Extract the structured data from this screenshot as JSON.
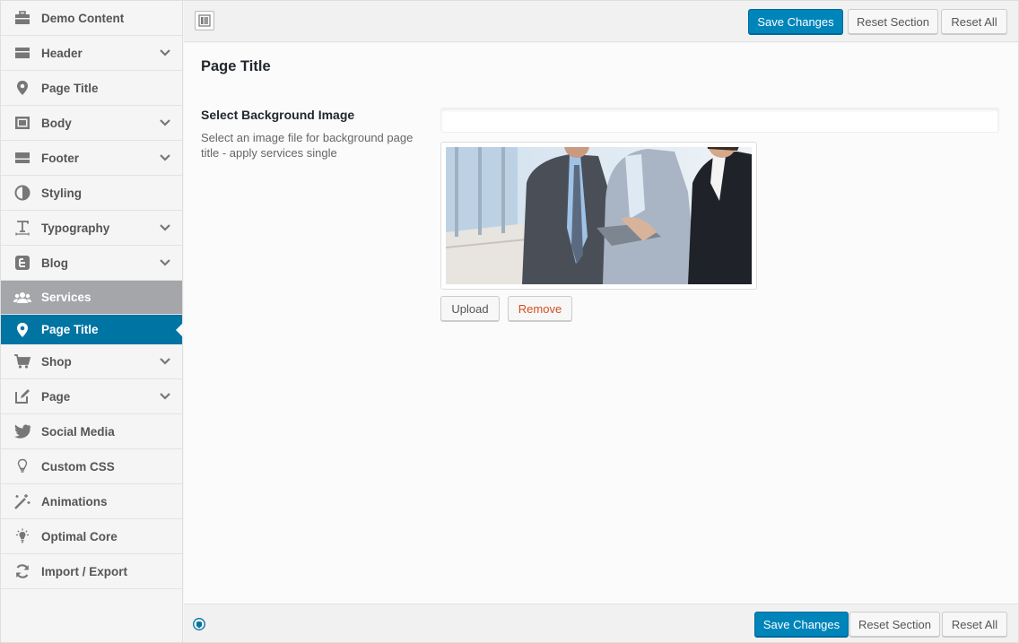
{
  "sidebar": {
    "items": [
      {
        "label": "Demo Content",
        "icon": "briefcase-icon",
        "has_children": false
      },
      {
        "label": "Header",
        "icon": "header-icon",
        "has_children": true
      },
      {
        "label": "Page Title",
        "icon": "location-pin-icon",
        "has_children": false
      },
      {
        "label": "Body",
        "icon": "body-layout-icon",
        "has_children": true
      },
      {
        "label": "Footer",
        "icon": "footer-icon",
        "has_children": true
      },
      {
        "label": "Styling",
        "icon": "contrast-icon",
        "has_children": false
      },
      {
        "label": "Typography",
        "icon": "text-size-icon",
        "has_children": true
      },
      {
        "label": "Blog",
        "icon": "blogger-icon",
        "has_children": true
      },
      {
        "label": "Services",
        "icon": "users-icon",
        "has_children": false
      },
      {
        "label": "Page Title",
        "icon": "location-pin-icon",
        "has_children": false
      },
      {
        "label": "Shop",
        "icon": "cart-icon",
        "has_children": true
      },
      {
        "label": "Page",
        "icon": "edit-icon",
        "has_children": true
      },
      {
        "label": "Social Media",
        "icon": "twitter-icon",
        "has_children": false
      },
      {
        "label": "Custom CSS",
        "icon": "lightbulb-icon",
        "has_children": false
      },
      {
        "label": "Animations",
        "icon": "magic-wand-icon",
        "has_children": false
      },
      {
        "label": "Optimal Core",
        "icon": "sparkle-bulb-icon",
        "has_children": false
      },
      {
        "label": "Import / Export",
        "icon": "refresh-icon",
        "has_children": false
      }
    ]
  },
  "toolbar": {
    "save_label": "Save Changes",
    "reset_section_label": "Reset Section",
    "reset_all_label": "Reset All"
  },
  "section": {
    "title": "Page Title",
    "field_title": "Select Background Image",
    "field_desc": "Select an image file for background page title - apply services single",
    "url_value": "",
    "upload_label": "Upload",
    "remove_label": "Remove"
  },
  "colors": {
    "primary": "#0085ba",
    "active_nav": "#0074a2",
    "parent_active_nav": "#a4a6a9",
    "remove_text": "#d54e21"
  }
}
